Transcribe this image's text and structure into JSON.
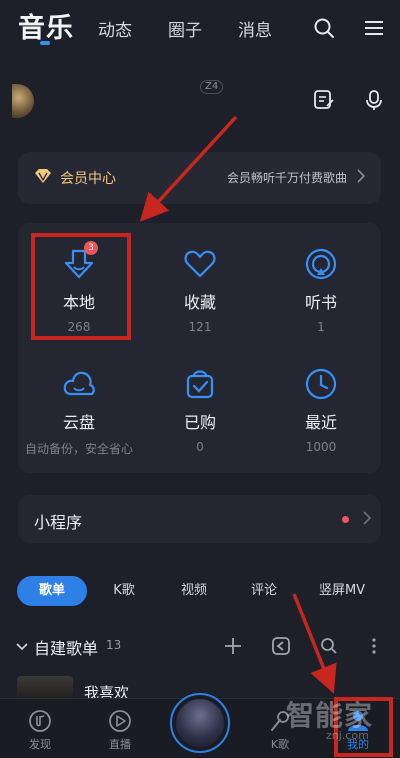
{
  "header": {
    "tabs": [
      {
        "label": "音乐",
        "active": true
      },
      {
        "label": "动态"
      },
      {
        "label": "圈子"
      },
      {
        "label": "消息"
      }
    ],
    "search_icon": "search-icon",
    "menu_icon": "menu-icon"
  },
  "profile": {
    "level_badge": "Z4",
    "actions": [
      "edit-note-icon",
      "voice-mic-icon"
    ]
  },
  "vip": {
    "title": "会员中心",
    "promo": "会员畅听千万付费歌曲",
    "accent": "#f0c77c"
  },
  "library": [
    {
      "label": "本地",
      "count": "268",
      "badge": "3",
      "icon": "download-icon"
    },
    {
      "label": "收藏",
      "count": "121",
      "icon": "heart-icon"
    },
    {
      "label": "听书",
      "count": "1",
      "icon": "audiobook-icon"
    },
    {
      "label": "云盘",
      "count": "自动备份，安全省心",
      "icon": "cloud-icon"
    },
    {
      "label": "已购",
      "count": "0",
      "icon": "purchased-bag-icon"
    },
    {
      "label": "最近",
      "count": "1000",
      "icon": "clock-icon"
    }
  ],
  "mini_programs": {
    "title": "小程序"
  },
  "content_tabs": [
    {
      "label": "歌单",
      "active": true
    },
    {
      "label": "K歌"
    },
    {
      "label": "视频"
    },
    {
      "label": "评论"
    },
    {
      "label": "竖屏MV"
    }
  ],
  "playlists": {
    "title": "自建歌单",
    "count": "13",
    "first_item": "我喜欢"
  },
  "bottom_nav": [
    {
      "label": "发现",
      "icon": "discover-icon"
    },
    {
      "label": "直播",
      "icon": "live-play-icon"
    },
    {
      "label": "",
      "icon": "now-playing-disc"
    },
    {
      "label": "K歌",
      "icon": "karaoke-icon"
    },
    {
      "label": "我的",
      "icon": "me-icon",
      "active": true
    }
  ],
  "watermark": {
    "text": "智能家",
    "sub": "znj.com"
  },
  "colors": {
    "accent": "#2e7fe6",
    "background": "#1d2029",
    "annotation": "#c8271f"
  }
}
